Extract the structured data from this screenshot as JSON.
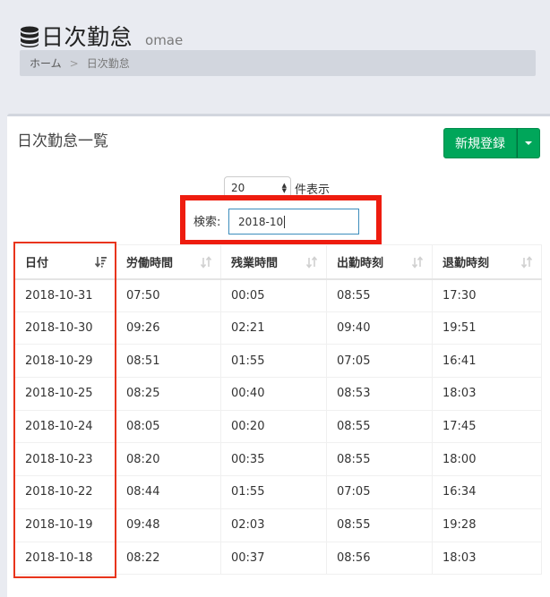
{
  "header": {
    "icon": "database-icon",
    "title": "日次勤怠",
    "subtitle": "omae"
  },
  "breadcrumb": {
    "home": "ホーム",
    "separator": ">",
    "current": "日次勤怠"
  },
  "panel": {
    "title": "日次勤怠一覧",
    "new_button": "新規登録"
  },
  "length": {
    "value": "20",
    "label": "件表示"
  },
  "search": {
    "label": "検索:",
    "value": "2018-10"
  },
  "table": {
    "columns": [
      "日付",
      "労働時間",
      "残業時間",
      "出勤時刻",
      "退勤時刻"
    ],
    "rows": [
      [
        "2018-10-31",
        "07:50",
        "00:05",
        "08:55",
        "17:30"
      ],
      [
        "2018-10-30",
        "09:26",
        "02:21",
        "09:40",
        "19:51"
      ],
      [
        "2018-10-29",
        "08:51",
        "01:55",
        "07:05",
        "16:41"
      ],
      [
        "2018-10-25",
        "08:25",
        "00:40",
        "08:53",
        "18:03"
      ],
      [
        "2018-10-24",
        "08:05",
        "00:20",
        "08:55",
        "17:45"
      ],
      [
        "2018-10-23",
        "08:20",
        "00:35",
        "08:55",
        "18:00"
      ],
      [
        "2018-10-22",
        "08:44",
        "01:55",
        "07:05",
        "16:34"
      ],
      [
        "2018-10-19",
        "09:48",
        "02:03",
        "08:55",
        "19:28"
      ],
      [
        "2018-10-18",
        "08:22",
        "00:37",
        "08:56",
        "18:03"
      ]
    ]
  },
  "colors": {
    "accent_green": "#00a65a",
    "highlight_red": "#ee1c0f",
    "input_border": "#3c8dbc"
  }
}
